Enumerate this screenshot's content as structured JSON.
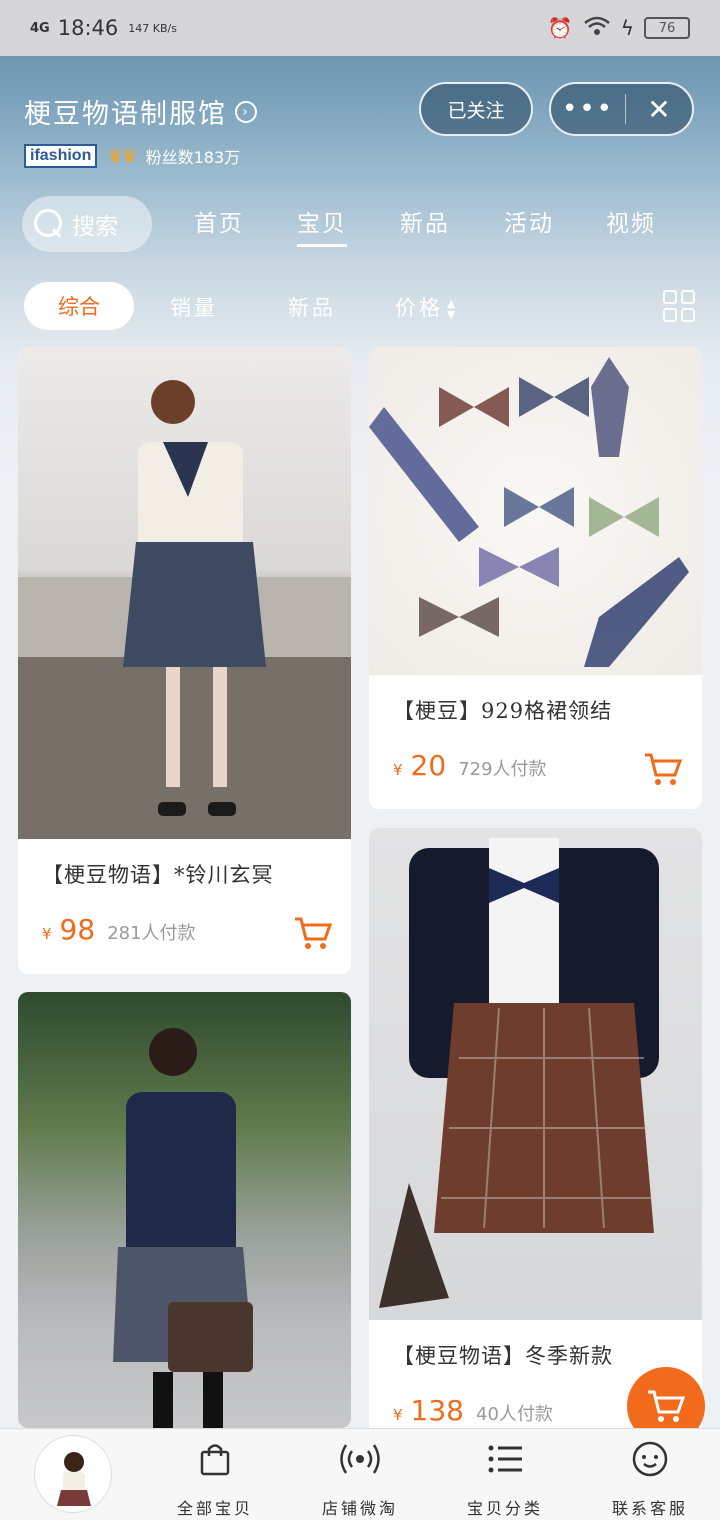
{
  "status": {
    "network": "4G",
    "time": "18:46",
    "speed": "147 KB/s",
    "battery": "76"
  },
  "shop": {
    "name": "梗豆物语制服馆",
    "brand_badge": "ifashion",
    "crowns": "♛♛",
    "fans": "粉丝数183万"
  },
  "actions": {
    "follow_label": "已关注",
    "more_label": "•••",
    "close_label": "✕"
  },
  "nav": {
    "search_label": "搜索",
    "tabs": [
      "首页",
      "宝贝",
      "新品",
      "活动",
      "视频"
    ],
    "active_tab": "宝贝"
  },
  "filters": {
    "items": [
      "综合",
      "销量",
      "新品",
      "价格"
    ],
    "active": "综合"
  },
  "products": [
    {
      "title": "【梗豆物语】*铃川玄冥",
      "currency": "¥",
      "price": "98",
      "sold": "281人付款"
    },
    {
      "title": "【梗豆】929格裙领结",
      "currency": "¥",
      "price": "20",
      "sold": "729人付款"
    },
    {
      "title": "【梗豆物语】冬季新款",
      "currency": "¥",
      "price": "138",
      "sold": "40人付款"
    }
  ],
  "bottom_bar": {
    "items": [
      "全部宝贝",
      "店铺微淘",
      "宝贝分类",
      "联系客服"
    ]
  },
  "colors": {
    "accent": "#f26a1b",
    "header_sky": "#5a86a3"
  }
}
